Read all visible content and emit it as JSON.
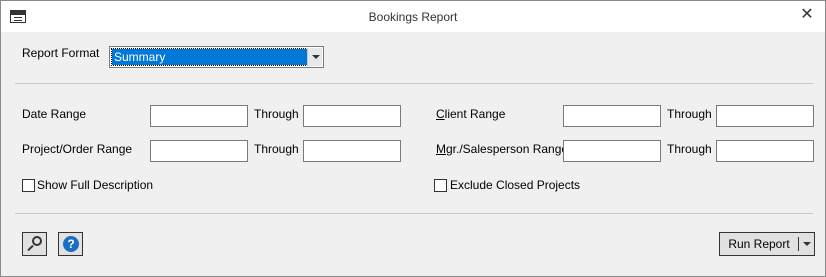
{
  "window": {
    "title": "Bookings Report"
  },
  "report_format": {
    "label": "Report Format",
    "selected": "Summary"
  },
  "fields": {
    "date_range": {
      "label": "Date Range",
      "from": "",
      "through_label": "Through",
      "through": ""
    },
    "project_order_range": {
      "label": "Project/Order Range",
      "from": "",
      "through_label": "Through",
      "through": ""
    },
    "client_range": {
      "label": "Client Range",
      "from": "",
      "through_label": "Through",
      "through": ""
    },
    "mgr_salesperson_range": {
      "label": "Mgr./Salesperson Range",
      "from": "",
      "through_label": "Through",
      "through": ""
    }
  },
  "checkboxes": {
    "show_full_description": {
      "label": "Show Full Description",
      "checked": false
    },
    "exclude_closed_projects": {
      "label": "Exclude Closed Projects",
      "checked": false
    }
  },
  "buttons": {
    "run_report": "Run Report",
    "help": "?"
  },
  "icons": {
    "app": "report-window-icon",
    "close": "close-icon",
    "search": "search-icon",
    "help": "help-icon",
    "dropdown": "chevron-down-icon"
  },
  "colors": {
    "selection": "#0078d7",
    "help_icon": "#1a6fc4",
    "background": "#f0f0f0"
  }
}
